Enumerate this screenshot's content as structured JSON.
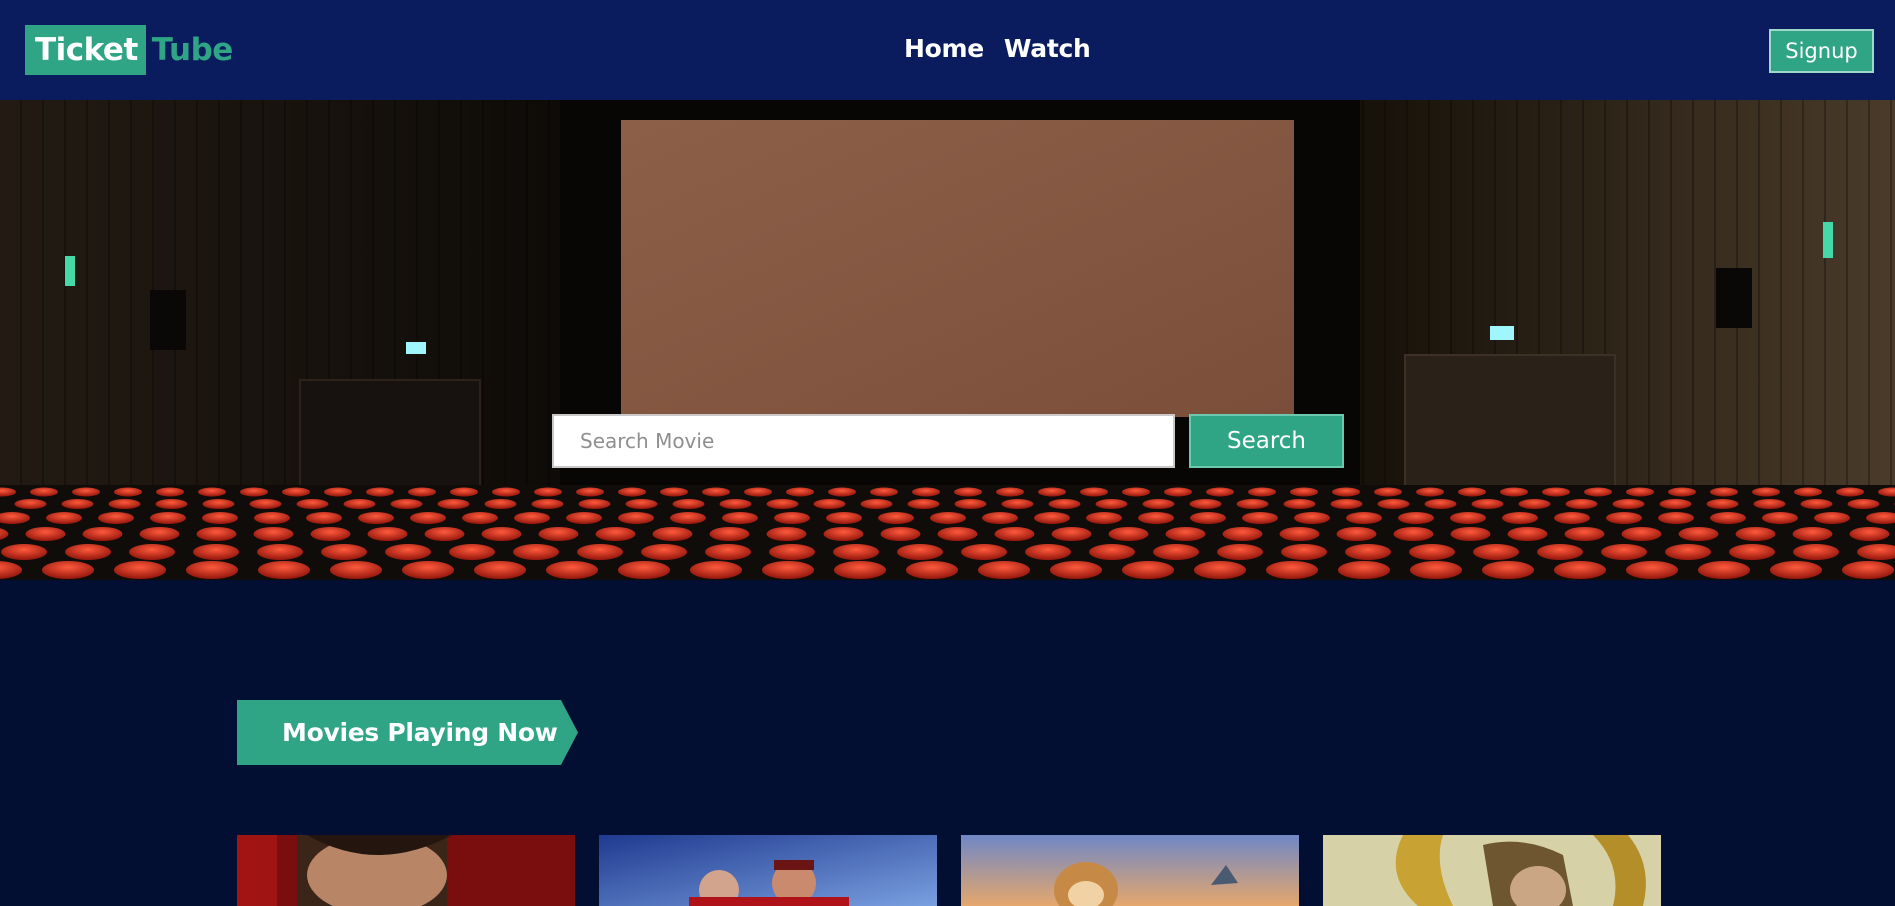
{
  "navbar": {
    "logo": {
      "part1": "Ticket",
      "part2": "Tube"
    },
    "links": [
      "Home",
      "Watch"
    ],
    "signup_label": "Signup"
  },
  "hero": {
    "search": {
      "placeholder": "Search Movie",
      "value": "",
      "button_label": "Search"
    }
  },
  "section": {
    "title": "Movies Playing Now"
  },
  "movies": [
    {
      "icon": "movie-poster-1"
    },
    {
      "icon": "movie-poster-2"
    },
    {
      "icon": "movie-poster-3"
    },
    {
      "icon": "movie-poster-4"
    }
  ],
  "colors": {
    "navbar_bg": "#0a1c5e",
    "page_bg": "#020f33",
    "accent": "#2fa585",
    "text_light": "#ffffff"
  }
}
